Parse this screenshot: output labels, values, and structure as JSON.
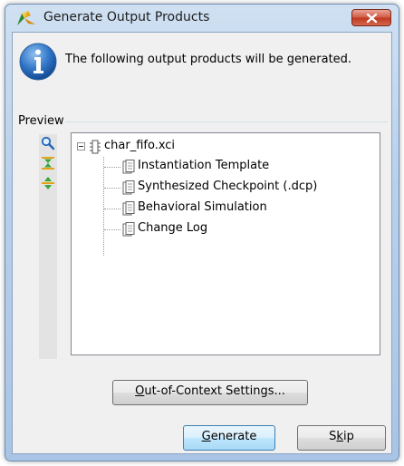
{
  "window": {
    "title": "Generate Output Products",
    "close_icon": "close-icon"
  },
  "message": "The following output products will be generated.",
  "preview": {
    "label": "Preview",
    "tools": [
      "search-icon",
      "collapse-all-icon",
      "expand-all-icon"
    ],
    "root": "char_fifo.xci",
    "children": [
      "Instantiation Template",
      "Synthesized Checkpoint (.dcp)",
      "Behavioral Simulation",
      "Change Log"
    ]
  },
  "buttons": {
    "ooc": {
      "mnemonic": "O",
      "rest": "ut-of-Context Settings..."
    },
    "generate": {
      "mnemonic": "G",
      "rest": "enerate"
    },
    "skip": {
      "pre": "S",
      "mnemonic": "k",
      "rest": "ip"
    }
  },
  "colors": {
    "titlebar": "#b9d0ea",
    "close_button": "#c0381f",
    "info_icon": "#1f5fb0",
    "default_button": "#bee6fd"
  }
}
